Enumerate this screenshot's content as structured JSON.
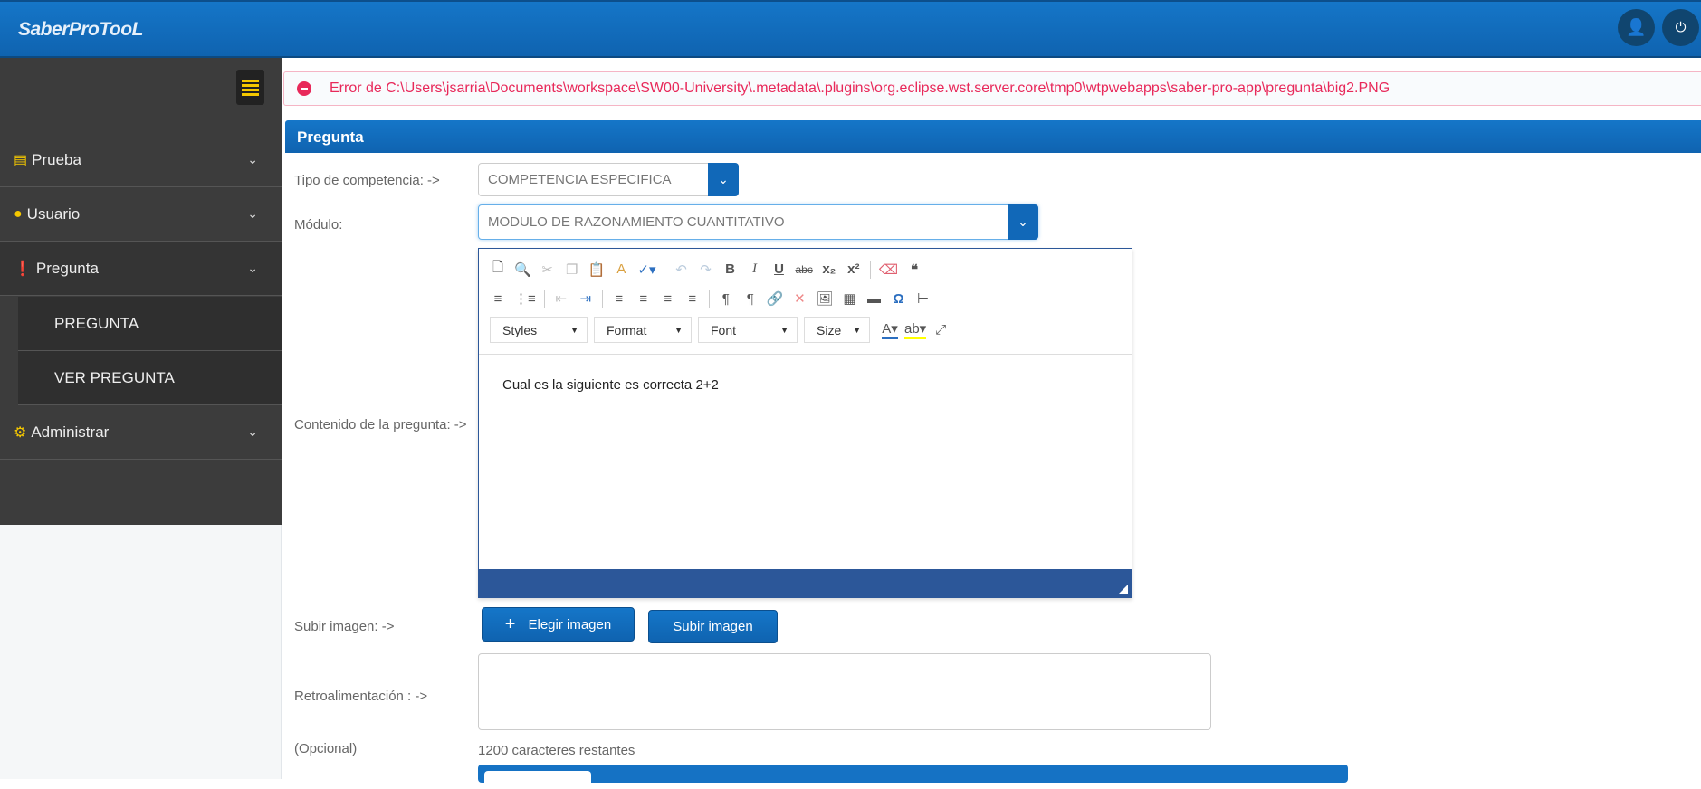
{
  "header": {
    "brand": "SaberProTooL",
    "user_icon": "user-icon",
    "power_icon": "power-icon"
  },
  "sidebar": {
    "items": [
      {
        "label": "Prueba",
        "icon": "list-icon"
      },
      {
        "label": "Usuario",
        "icon": "users-icon"
      },
      {
        "label": "Pregunta",
        "icon": "exclamation-icon"
      },
      {
        "label": "PREGUNTA"
      },
      {
        "label": "VER PREGUNTA"
      },
      {
        "label": "Administrar",
        "icon": "gears-icon"
      }
    ]
  },
  "error": {
    "message": "Error de C:\\Users\\jsarria\\Documents\\workspace\\SW00-University\\.metadata\\.plugins\\org.eclipse.wst.server.core\\tmp0\\wtpwebapps\\saber-pro-app\\pregunta\\big2.PNG"
  },
  "panel": {
    "title": "Pregunta"
  },
  "form": {
    "tipo_label": "Tipo de competencia: ->",
    "tipo_value": "COMPETENCIA ESPECIFICA",
    "modulo_label": "Módulo:",
    "modulo_value": "MODULO DE RAZONAMIENTO CUANTITATIVO",
    "contenido_label": "Contenido de la pregunta: ->",
    "subir_label": "Subir imagen: ->",
    "elegir_button": "Elegir imagen",
    "subir_button": "Subir imagen",
    "retro_label": "Retroalimentación : ->",
    "opcional_label": "(Opcional)",
    "chars_remaining": "1200 caracteres restantes"
  },
  "editor": {
    "content": "Cual es la siguiente es correcta 2+2",
    "dropdowns": [
      "Styles",
      "Format",
      "Font",
      "Size"
    ]
  },
  "colors": {
    "primary": "#1168b8",
    "error": "#e8295a",
    "sidebar": "#3c3c3c",
    "accent": "#f5c800"
  }
}
